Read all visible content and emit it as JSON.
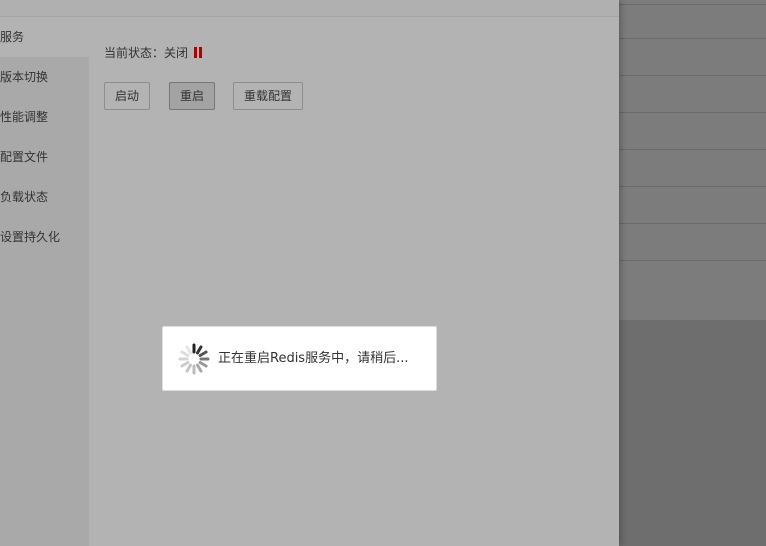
{
  "sidebar": {
    "items": [
      {
        "label": "服务",
        "active": true
      },
      {
        "label": "版本切换"
      },
      {
        "label": "性能调整"
      },
      {
        "label": "配置文件"
      },
      {
        "label": "负载状态"
      },
      {
        "label": "设置持久化"
      }
    ]
  },
  "service": {
    "status_label": "当前状态：",
    "status_value": "关闭",
    "status_color": "#b00000",
    "buttons": {
      "start": "启动",
      "restart": "重启",
      "reload_config": "重载配置"
    }
  },
  "loading": {
    "message": "正在重启Redis服务中，请稍后...",
    "icon": "spinner-icon"
  }
}
